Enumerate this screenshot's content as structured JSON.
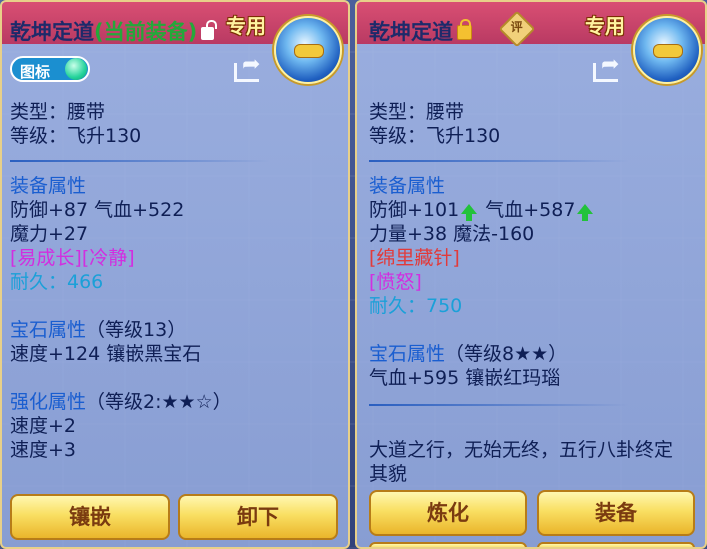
{
  "left_panel": {
    "title": "乾坤定道",
    "title_tag": "(当前装备)",
    "exclusive": "专用",
    "toggle_label": "图标",
    "type_line": "类型：腰带",
    "level_line": "等级：飞升130",
    "equip_header": "装备属性",
    "equip_line1": "防御+87 气血+522",
    "equip_line2": "魔力+27",
    "special": "[易成长][冷静]",
    "durability": "耐久：466",
    "gem_header": "宝石属性",
    "gem_level": "（等级13）",
    "gem_line": "速度+124 镶嵌黑宝石",
    "enhance_header": "强化属性",
    "enhance_level": "（等级2:★★☆）",
    "enhance_line1": "速度+2",
    "enhance_line2": "速度+3",
    "buttons": [
      "镶嵌",
      "卸下"
    ]
  },
  "right_panel": {
    "title": "乾坤定道",
    "appraise": "评",
    "exclusive": "专用",
    "type_line": "类型：腰带",
    "level_line": "等级：飞升130",
    "equip_header": "装备属性",
    "def_text": "防御+101",
    "hp_text": "气血+587",
    "equip_line2": "力量+38 魔法-160",
    "special1": "[绵里藏针]",
    "special2": "[愤怒]",
    "durability": "耐久：750",
    "gem_header": "宝石属性",
    "gem_level": "（等级8★★）",
    "gem_line": "气血+595 镶嵌红玛瑙",
    "desc_line1": "大道之行，无始无终，五行八卦终定",
    "desc_line2": "其貌",
    "buttons": [
      "炼化",
      "装备"
    ]
  }
}
